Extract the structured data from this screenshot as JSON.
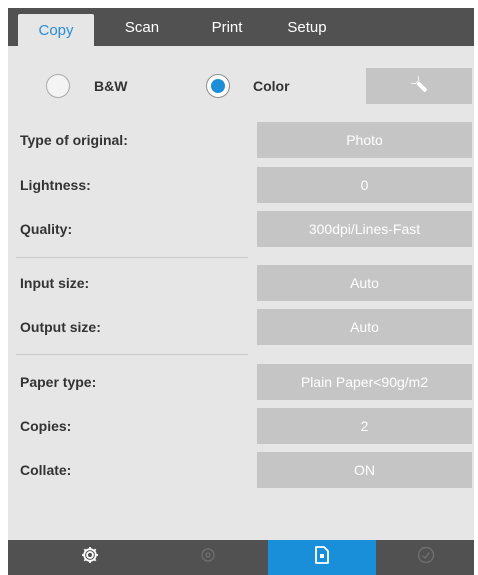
{
  "tabs": [
    {
      "label": "Copy",
      "active": true
    },
    {
      "label": "Scan",
      "active": false
    },
    {
      "label": "Print",
      "active": false
    },
    {
      "label": "Setup",
      "active": false
    }
  ],
  "color_mode": {
    "options": [
      {
        "label": "B&W",
        "selected": false
      },
      {
        "label": "Color",
        "selected": true
      }
    ],
    "settings_icon": "wrench-icon"
  },
  "settings": [
    {
      "label": "Type of original:",
      "value": "Photo"
    },
    {
      "label": "Lightness:",
      "value": "0"
    },
    {
      "label": "Quality:",
      "value": "300dpi/Lines-Fast"
    },
    {
      "label": "Input size:",
      "value": "Auto"
    },
    {
      "label": "Output size:",
      "value": "Auto"
    },
    {
      "label": "Paper type:",
      "value": "Plain Paper<90g/m2"
    },
    {
      "label": "Copies:",
      "value": "2"
    },
    {
      "label": "Collate:",
      "value": "ON"
    }
  ],
  "bottom_bar": [
    {
      "icon": "gear-icon",
      "enabled": true
    },
    {
      "icon": "stop-icon",
      "enabled": false
    },
    {
      "icon": "preview-document-icon",
      "enabled": true,
      "active": true
    },
    {
      "icon": "check-icon",
      "enabled": false
    }
  ],
  "colors": {
    "accent": "#1a8fd9",
    "bar": "#515151",
    "panel": "#e6e6e6",
    "button": "#c5c5c5"
  }
}
